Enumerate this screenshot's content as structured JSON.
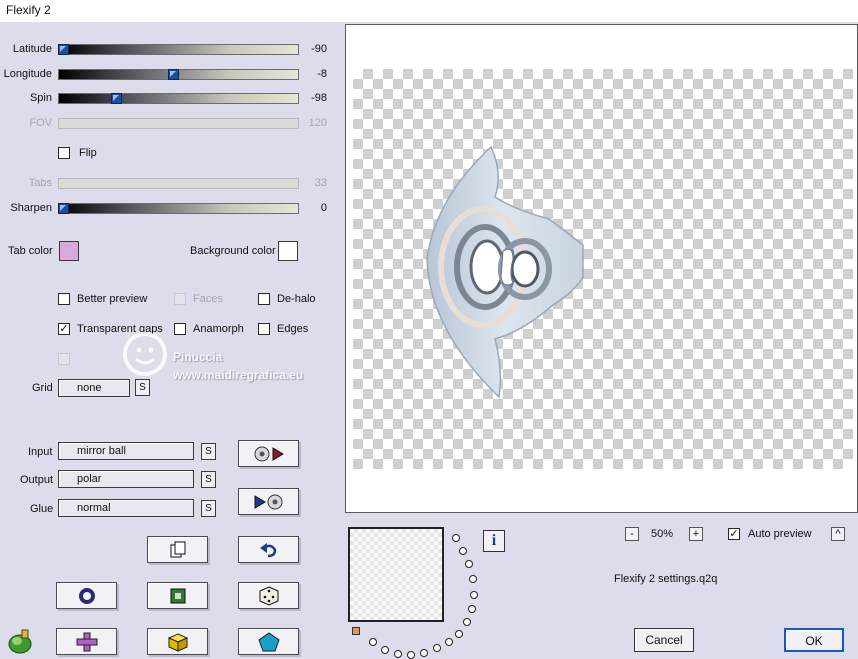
{
  "window": {
    "title": "Flexify 2"
  },
  "sliders": [
    {
      "label": "Latitude",
      "value": "-90",
      "level": 0.0,
      "enabled": true
    },
    {
      "label": "Longitude",
      "value": "-8",
      "level": 0.48,
      "enabled": true
    },
    {
      "label": "Spin",
      "value": "-98",
      "level": 0.23,
      "enabled": true
    },
    {
      "label": "FOV",
      "value": "120",
      "level": 1.0,
      "enabled": false
    },
    {
      "label": "Tabs",
      "value": "33",
      "level": 1.0,
      "enabled": false
    },
    {
      "label": "Sharpen",
      "value": "0",
      "level": 0.0,
      "enabled": true
    }
  ],
  "flip": {
    "label": "Flip",
    "checked": false
  },
  "colors": {
    "tab_label": "Tab color",
    "tab_color": "#d9a8dc",
    "background_label": "Background color",
    "background_color": "#ffffff"
  },
  "options": {
    "better_preview": "Better preview",
    "faces": "Faces",
    "dehalo": "De-halo",
    "transparent_gaps": "Transparent gaps",
    "anamorph": "Anamorph",
    "edges": "Edges"
  },
  "watermark": {
    "name": "Pinuccia",
    "url": "www.maidiregrafica.eu"
  },
  "grid": {
    "label": "Grid",
    "value": "none",
    "s": "S"
  },
  "projection": {
    "input_label": "Input",
    "input_value": "mirror ball",
    "output_label": "Output",
    "output_value": "polar",
    "glue_label": "Glue",
    "glue_value": "normal",
    "s": "S"
  },
  "preview_controls": {
    "zoom_minus": "-",
    "zoom": "50%",
    "zoom_plus": "+",
    "auto_preview_label": "Auto preview",
    "auto_preview_checked": true,
    "expand": "^",
    "info": "i",
    "settings_file": "Flexify 2 settings.q2q"
  },
  "buttons": {
    "cancel": "Cancel",
    "ok": "OK"
  }
}
